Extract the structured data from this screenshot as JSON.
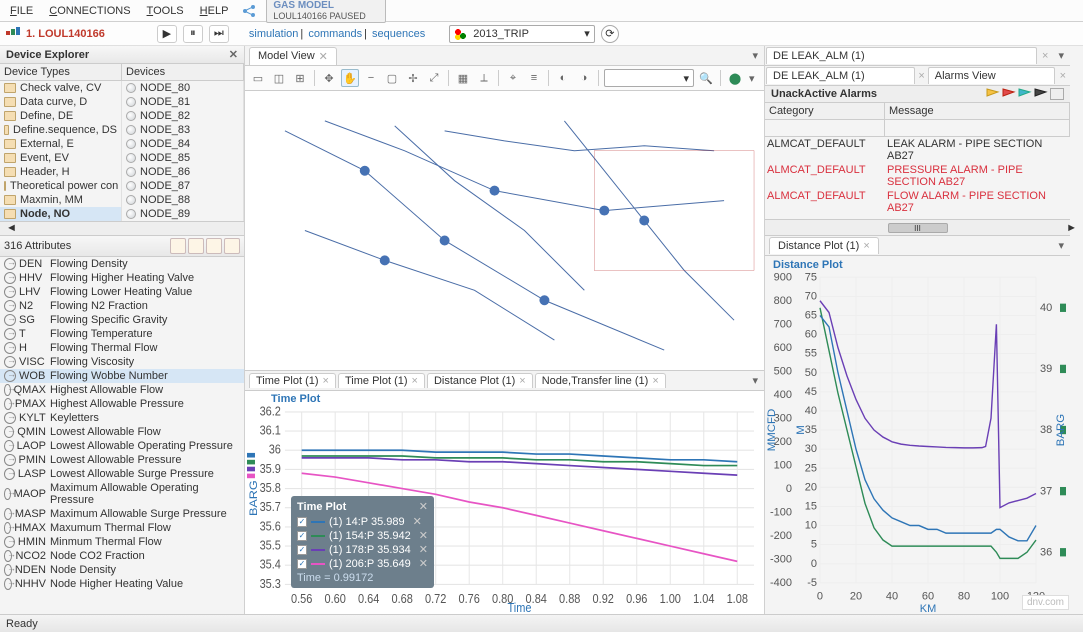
{
  "menu": {
    "items": [
      "FILE",
      "CONNECTIONS",
      "TOOLS",
      "HELP"
    ]
  },
  "model_badge": {
    "title": "GAS MODEL",
    "sub": "LOUL140166  PAUSED"
  },
  "topstrip": {
    "project_label": "1. LOUL140166",
    "links": [
      "simulation",
      "commands",
      "sequences"
    ],
    "combo_value": "2013_TRIP"
  },
  "device_explorer": {
    "title": "Device Explorer",
    "col_types": "Device Types",
    "col_devices": "Devices",
    "types": [
      "Check valve, CV",
      "Data curve, D",
      "Define, DE",
      "Define.sequence, DS",
      "External, E",
      "Event, EV",
      "Header, H",
      "Theoretical power con",
      "Maxmin, MM",
      "Node, NO"
    ],
    "selected_type_index": 9,
    "devices": [
      "NODE_80",
      "NODE_81",
      "NODE_82",
      "NODE_83",
      "NODE_84",
      "NODE_85",
      "NODE_86",
      "NODE_87",
      "NODE_88",
      "NODE_89"
    ]
  },
  "attributes": {
    "title": "316 Attributes",
    "list": [
      {
        "code": "DEN",
        "desc": "Flowing Density"
      },
      {
        "code": "HHV",
        "desc": "Flowing Higher Heating Valve"
      },
      {
        "code": "LHV",
        "desc": "Flowing Lower Heating Value"
      },
      {
        "code": "N2",
        "desc": "Flowing N2 Fraction"
      },
      {
        "code": "SG",
        "desc": "Flowing Specific Gravity"
      },
      {
        "code": "T",
        "desc": "Flowing Temperature"
      },
      {
        "code": "H",
        "desc": "Flowing Thermal Flow"
      },
      {
        "code": "VISC",
        "desc": "Flowing Viscosity"
      },
      {
        "code": "WOB",
        "desc": "Flowing Wobbe Number"
      },
      {
        "code": "QMAX",
        "desc": "Highest Allowable Flow"
      },
      {
        "code": "PMAX",
        "desc": "Highest Allowable Pressure"
      },
      {
        "code": "KYLT",
        "desc": "Keyletters"
      },
      {
        "code": "QMIN",
        "desc": "Lowest Allowable Flow"
      },
      {
        "code": "LAOP",
        "desc": "Lowest Allowable Operating Pressure"
      },
      {
        "code": "PMIN",
        "desc": "Lowest Allowable Pressure"
      },
      {
        "code": "LASP",
        "desc": "Lowest Allowable Surge Pressure"
      },
      {
        "code": "MAOP",
        "desc": "Maximum Allowable Operating Pressure"
      },
      {
        "code": "MASP",
        "desc": "Maximum Allowable Surge Pressure"
      },
      {
        "code": "HMAX",
        "desc": "Maxumum Thermal Flow"
      },
      {
        "code": "HMIN",
        "desc": "Minmum Thermal Flow"
      },
      {
        "code": "NCO2",
        "desc": "Node CO2 Fraction"
      },
      {
        "code": "NDEN",
        "desc": "Node Density"
      },
      {
        "code": "NHHV",
        "desc": "Node Higher Heating Value"
      }
    ],
    "selected_index": 8
  },
  "model_view": {
    "tab": "Model View"
  },
  "plot_tabs": [
    "Time Plot (1)",
    "Time Plot (1)",
    "Distance Plot (1)",
    "Node,Transfer line (1)"
  ],
  "time_plot": {
    "title": "Time Plot",
    "ylabel": "BARG",
    "xlabel": "Time",
    "legend_title": "Time Plot",
    "legend_time": "Time = 0.99172",
    "legend": [
      {
        "label": "(1)  14:P  35.989",
        "color": "#2e75b6"
      },
      {
        "label": "(1)  154:P  35.942",
        "color": "#2e8b57"
      },
      {
        "label": "(1)  178:P  35.934",
        "color": "#6a3fb5"
      },
      {
        "label": "(1)  206:P  35.649",
        "color": "#e754c4"
      }
    ]
  },
  "de_tabs": [
    {
      "label": "DE  LEAK_ALM (1)"
    },
    {
      "label": "DE  LEAK_ALM (1)"
    },
    {
      "label": "Alarms View"
    }
  ],
  "alarms": {
    "title": "UnackActive Alarms",
    "col_cat": "Category",
    "col_msg": "Message",
    "rows": [
      {
        "cat": "ALMCAT_DEFAULT",
        "msg": "LEAK ALARM - PIPE SECTION AB27",
        "sev": "normal"
      },
      {
        "cat": "ALMCAT_DEFAULT",
        "msg": "PRESSURE ALARM - PIPE SECTION AB27",
        "sev": "red"
      },
      {
        "cat": "ALMCAT_DEFAULT",
        "msg": "FLOW ALARM - PIPE SECTION AB27",
        "sev": "red"
      }
    ],
    "scroll_label": "III"
  },
  "distance_plot": {
    "tab": "Distance Plot (1)",
    "title": "Distance Plot",
    "xlabel": "KM",
    "ylabel_left": "MMCFD",
    "ylabel_mid": "M",
    "ylabel_right": "BARG"
  },
  "status": "Ready",
  "watermark": "dnv.com",
  "chart_data": [
    {
      "type": "line",
      "title": "Time Plot",
      "xlabel": "Time",
      "ylabel": "BARG",
      "xlim": [
        0.54,
        1.1
      ],
      "ylim": [
        35.3,
        36.2
      ],
      "x": [
        0.56,
        0.6,
        0.64,
        0.68,
        0.72,
        0.76,
        0.8,
        0.84,
        0.88,
        0.92,
        0.96,
        1.0,
        1.04,
        1.08
      ],
      "series": [
        {
          "name": "(1) 14:P",
          "color": "#2e75b6",
          "values": [
            36.0,
            36.0,
            36.0,
            36.0,
            35.99,
            35.99,
            35.99,
            35.98,
            35.98,
            35.97,
            35.96,
            35.95,
            35.95,
            35.94
          ]
        },
        {
          "name": "(1) 154:P",
          "color": "#2e8b57",
          "values": [
            35.97,
            35.97,
            35.97,
            35.97,
            35.96,
            35.96,
            35.96,
            35.95,
            35.95,
            35.94,
            35.94,
            35.93,
            35.92,
            35.92
          ]
        },
        {
          "name": "(1) 178:P",
          "color": "#6a3fb5",
          "values": [
            35.96,
            35.96,
            35.96,
            35.95,
            35.95,
            35.94,
            35.94,
            35.93,
            35.92,
            35.91,
            35.9,
            35.89,
            35.88,
            35.87
          ]
        },
        {
          "name": "(1) 206:P",
          "color": "#e754c4",
          "values": [
            35.88,
            35.86,
            35.83,
            35.8,
            35.77,
            35.73,
            35.7,
            35.66,
            35.62,
            35.58,
            35.54,
            35.5,
            35.46,
            35.42
          ]
        }
      ]
    },
    {
      "type": "line",
      "title": "Distance Plot",
      "xlabel": "KM",
      "xlim": [
        0,
        120
      ],
      "axes": [
        {
          "name": "MMCFD",
          "range": [
            -400,
            900
          ],
          "ticks": [
            -400,
            -300,
            -200,
            -100,
            0,
            100,
            200,
            300,
            400,
            500,
            600,
            700,
            800,
            900
          ]
        },
        {
          "name": "M",
          "range": [
            -5,
            75
          ],
          "ticks": [
            -5,
            0,
            5,
            10,
            15,
            20,
            25,
            30,
            35,
            40,
            45,
            50,
            55,
            60,
            65,
            70,
            75
          ]
        },
        {
          "name": "BARG",
          "range": [
            35.5,
            40.5
          ],
          "ticks": [
            36,
            37,
            38,
            39,
            40
          ]
        }
      ],
      "x": [
        0,
        5,
        10,
        15,
        20,
        25,
        30,
        35,
        40,
        45,
        50,
        55,
        60,
        65,
        70,
        75,
        80,
        85,
        90,
        92,
        95,
        98,
        100,
        105,
        110,
        115,
        120
      ],
      "series": [
        {
          "name": "BARG",
          "axis": "BARG",
          "color": "#2e8b57",
          "values": [
            40.0,
            39.3,
            38.6,
            38.0,
            37.4,
            36.8,
            36.4,
            36.2,
            36.1,
            36.1,
            36.1,
            36.1,
            36.1,
            36.1,
            36.1,
            36.1,
            36.1,
            36.1,
            36.1,
            36.1,
            36.1,
            36.0,
            35.9,
            35.9,
            35.9,
            36.0,
            36.2
          ]
        },
        {
          "name": "M",
          "axis": "M",
          "color": "#2e75b6",
          "values": [
            65,
            62,
            50,
            40,
            30,
            22,
            17,
            14,
            12,
            11,
            10,
            10,
            9,
            9,
            8,
            8,
            8,
            8,
            8,
            8,
            8,
            9,
            9,
            7,
            6,
            6,
            10
          ]
        },
        {
          "name": "MMCFD",
          "axis": "MMCFD",
          "color": "#6a3fb5",
          "values": [
            800,
            750,
            600,
            480,
            380,
            300,
            250,
            220,
            200,
            190,
            185,
            182,
            180,
            178,
            176,
            175,
            174,
            174,
            175,
            180,
            300,
            700,
            -80,
            -60,
            -50,
            -40,
            -20
          ]
        }
      ]
    }
  ]
}
